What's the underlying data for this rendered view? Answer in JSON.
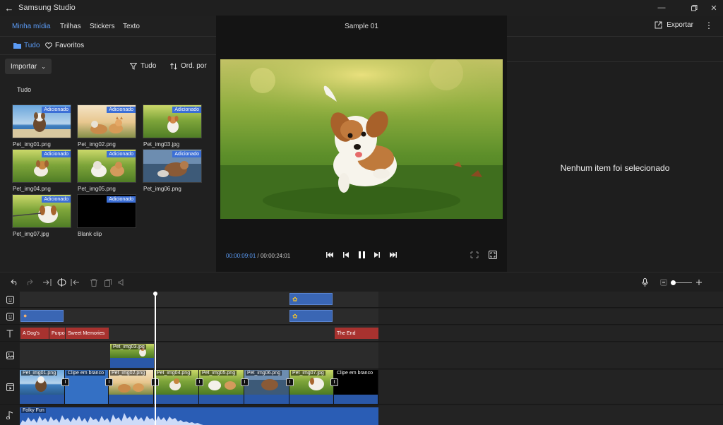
{
  "app": {
    "title": "Samsung Studio"
  },
  "media": {
    "tabs": [
      "Minha mídia",
      "Trilhas",
      "Stickers",
      "Texto"
    ],
    "filters": {
      "all": "Tudo",
      "favorites": "Favoritos"
    },
    "import_label": "Importar",
    "filter_label": "Tudo",
    "sort_label": "Ord. por",
    "section": "Tudo",
    "badge": "Adicionado",
    "items": [
      {
        "name": "Pet_img01.png"
      },
      {
        "name": "Pet_img02.png"
      },
      {
        "name": "Pet_img03.jpg"
      },
      {
        "name": "Pet_img04.png"
      },
      {
        "name": "Pet_img05.png"
      },
      {
        "name": "Pet_img06.png"
      },
      {
        "name": "Pet_img07.jpg"
      },
      {
        "name": "Blank clip"
      }
    ]
  },
  "preview": {
    "title": "Sample 01",
    "current_time": "00:00:09:01",
    "total_time": "/ 00:00:24:01"
  },
  "inspector": {
    "export_label": "Exportar",
    "empty_message": "Nenhum item foi selecionado"
  },
  "timeline": {
    "text_clips": [
      "A Dog's",
      "Purpo",
      "Sweet Memories",
      "The End"
    ],
    "overlay_clip": "Pet_img03.jpg",
    "video_clips": [
      "Pet_img01.png",
      "Clipe em branco",
      "Pet_img02.png",
      "Pet_img04.png",
      "Pet_img05.png",
      "Pet_img06.png",
      "Pet_img07.jpg",
      "Clipe em branco"
    ],
    "audio_clip": "Folky Fun"
  },
  "colors": {
    "accent": "#5b9bf5",
    "clip_blue": "#3a66b4",
    "text_clip_red": "#a8322f",
    "badge": "#3c6fd6"
  }
}
